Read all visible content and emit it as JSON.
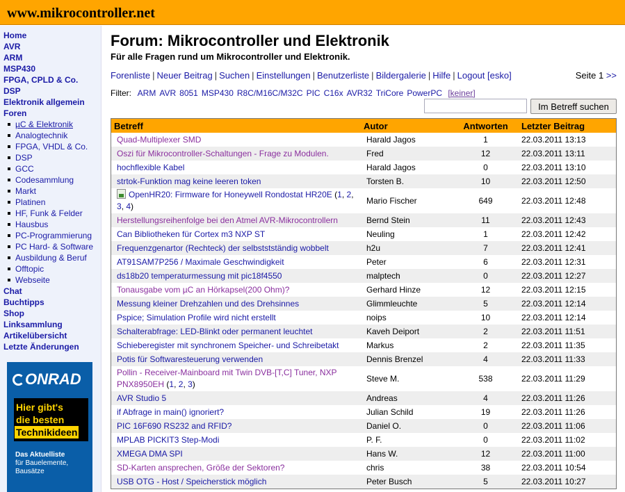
{
  "site": {
    "title": "www.mikrocontroller.net"
  },
  "sidebar": {
    "items": [
      {
        "label": "Home",
        "level": 0
      },
      {
        "label": "AVR",
        "level": 0
      },
      {
        "label": "ARM",
        "level": 0
      },
      {
        "label": "MSP430",
        "level": 0
      },
      {
        "label": "FPGA, CPLD & Co.",
        "level": 0
      },
      {
        "label": "DSP",
        "level": 0
      },
      {
        "label": "Elektronik allgemein",
        "level": 0
      },
      {
        "label": "Foren",
        "level": 0
      },
      {
        "label": "µC & Elektronik",
        "level": 1,
        "active": true
      },
      {
        "label": "Analogtechnik",
        "level": 1
      },
      {
        "label": "FPGA, VHDL & Co.",
        "level": 1
      },
      {
        "label": "DSP",
        "level": 1
      },
      {
        "label": "GCC",
        "level": 1
      },
      {
        "label": "Codesammlung",
        "level": 1
      },
      {
        "label": "Markt",
        "level": 1
      },
      {
        "label": "Platinen",
        "level": 1
      },
      {
        "label": "HF, Funk & Felder",
        "level": 1
      },
      {
        "label": "Hausbus",
        "level": 1
      },
      {
        "label": "PC-Programmierung",
        "level": 1
      },
      {
        "label": "PC Hard- & Software",
        "level": 1
      },
      {
        "label": "Ausbildung & Beruf",
        "level": 1
      },
      {
        "label": "Offtopic",
        "level": 1
      },
      {
        "label": "Webseite",
        "level": 1
      },
      {
        "label": "Chat",
        "level": 0
      },
      {
        "label": "Buchtipps",
        "level": 0
      },
      {
        "label": "Shop",
        "level": 0
      },
      {
        "label": "Linksammlung",
        "level": 0
      },
      {
        "label": "Artikelübersicht",
        "level": 0
      },
      {
        "label": "Letzte Änderungen",
        "level": 0
      }
    ]
  },
  "ad": {
    "brand": "ONRAD",
    "headline_lines": [
      "Hier gibt's",
      "die besten",
      "Technikideen"
    ],
    "small_bold": "Das Aktuelliste",
    "small_lines": [
      "für Bauelemente,",
      "Bausätze"
    ],
    "brand_color": "#0a5ea8",
    "accent_color": "#ffd400"
  },
  "forum": {
    "title": "Forum: Mikrocontroller und Elektronik",
    "subtitle": "Für alle Fragen rund um Mikrocontroller und Elektronik.",
    "menu": [
      "Forenliste",
      "Neuer Beitrag",
      "Suchen",
      "Einstellungen",
      "Benutzerliste",
      "Bildergalerie",
      "Hilfe",
      "Logout [esko]"
    ],
    "pager": {
      "label": "Seite 1",
      "next": ">>"
    },
    "filter": {
      "label": "Filter:",
      "options": [
        "ARM",
        "AVR",
        "8051",
        "MSP430",
        "R8C/M16C/M32C",
        "PIC",
        "C16x",
        "AVR32",
        "TriCore",
        "PowerPC"
      ],
      "none": "[keiner]"
    },
    "search": {
      "placeholder": "",
      "button": "Im Betreff suchen"
    }
  },
  "table": {
    "headers": {
      "subject": "Betreff",
      "author": "Autor",
      "replies": "Antworten",
      "last": "Letzter Beitrag"
    },
    "rows": [
      {
        "subject": "Quad-Multiplexer SMD",
        "author": "Harald Jagos",
        "replies": "1",
        "last": "22.03.2011 13:13",
        "visited": true
      },
      {
        "subject": "Oszi für Mikrocontroller-Schaltungen - Frage zu Modulen.",
        "author": "Fred",
        "replies": "12",
        "last": "22.03.2011 13:11",
        "visited": true
      },
      {
        "subject": "hochflexible Kabel",
        "author": "Harald Jagos",
        "replies": "0",
        "last": "22.03.2011 13:10"
      },
      {
        "subject": "strtok-Funktion mag keine leeren token",
        "author": "Torsten B.",
        "replies": "10",
        "last": "22.03.2011 12:50"
      },
      {
        "subject": "OpenHR20: Firmware for Honeywell Rondostat HR20E",
        "author": "Mario Fischer",
        "replies": "649",
        "last": "22.03.2011 12:48",
        "pages": [
          "1",
          "2",
          "3",
          "4"
        ],
        "attachment": true
      },
      {
        "subject": "Herstellungsreihenfolge bei den Atmel AVR-Mikrocontrollern",
        "author": "Bernd Stein",
        "replies": "11",
        "last": "22.03.2011 12:43",
        "visited": true
      },
      {
        "subject": "Can Bibliotheken für Cortex m3 NXP ST",
        "author": "Neuling",
        "replies": "1",
        "last": "22.03.2011 12:42"
      },
      {
        "subject": "Frequenzgenartor (Rechteck) der selbststständig wobbelt",
        "author": "h2u",
        "replies": "7",
        "last": "22.03.2011 12:41"
      },
      {
        "subject": "AT91SAM7P256 / Maximale Geschwindigkeit",
        "author": "Peter",
        "replies": "6",
        "last": "22.03.2011 12:31"
      },
      {
        "subject": "ds18b20 temperaturmessung mit pic18f4550",
        "author": "malptech",
        "replies": "0",
        "last": "22.03.2011 12:27"
      },
      {
        "subject": "Tonausgabe vom µC an Hörkapsel(200 Ohm)?",
        "author": "Gerhard Hinze",
        "replies": "12",
        "last": "22.03.2011 12:15",
        "visited": true
      },
      {
        "subject": "Messung kleiner Drehzahlen und des Drehsinnes",
        "author": "Glimmleuchte",
        "replies": "5",
        "last": "22.03.2011 12:14"
      },
      {
        "subject": "Pspice; Simulation Profile wird nicht erstellt",
        "author": "noips",
        "replies": "10",
        "last": "22.03.2011 12:14"
      },
      {
        "subject": "Schalterabfrage: LED-Blinkt oder permanent leuchtet",
        "author": "Kaveh Deiport",
        "replies": "2",
        "last": "22.03.2011 11:51"
      },
      {
        "subject": "Schieberegister mit synchronem Speicher- und Schreibetakt",
        "author": "Markus",
        "replies": "2",
        "last": "22.03.2011 11:35"
      },
      {
        "subject": "Potis für Softwaresteuerung verwenden",
        "author": "Dennis Brenzel",
        "replies": "4",
        "last": "22.03.2011 11:33"
      },
      {
        "subject": "Pollin - Receiver-Mainboard mit Twin DVB-[T,C] Tuner, NXP PNX8950EH",
        "author": "Steve M.",
        "replies": "538",
        "last": "22.03.2011 11:29",
        "pages": [
          "1",
          "2",
          "3"
        ],
        "visited": true
      },
      {
        "subject": "AVR Studio 5",
        "author": "Andreas",
        "replies": "4",
        "last": "22.03.2011 11:26"
      },
      {
        "subject": "if Abfrage in main() ignoriert?",
        "author": "Julian Schild",
        "replies": "19",
        "last": "22.03.2011 11:26"
      },
      {
        "subject": "PIC 16F690 RS232 and RFID?",
        "author": "Daniel O.",
        "replies": "0",
        "last": "22.03.2011 11:06"
      },
      {
        "subject": "MPLAB PICKIT3 Step-Modi",
        "author": "P. F.",
        "replies": "0",
        "last": "22.03.2011 11:02"
      },
      {
        "subject": "XMEGA DMA SPI",
        "author": "Hans W.",
        "replies": "12",
        "last": "22.03.2011 11:00"
      },
      {
        "subject": "SD-Karten ansprechen, Größe der Sektoren?",
        "author": "chris",
        "replies": "38",
        "last": "22.03.2011 10:54",
        "visited": true
      },
      {
        "subject": "USB OTG - Host / Speicherstick möglich",
        "author": "Peter Busch",
        "replies": "5",
        "last": "22.03.2011 10:27"
      }
    ]
  },
  "colors": {
    "header_bar": "#ffa500",
    "link": "#1a1aa6",
    "visited_link": "#8a2f9e",
    "sidebar_bg": "#eef2fb",
    "row_alt": "#eeeeee"
  }
}
